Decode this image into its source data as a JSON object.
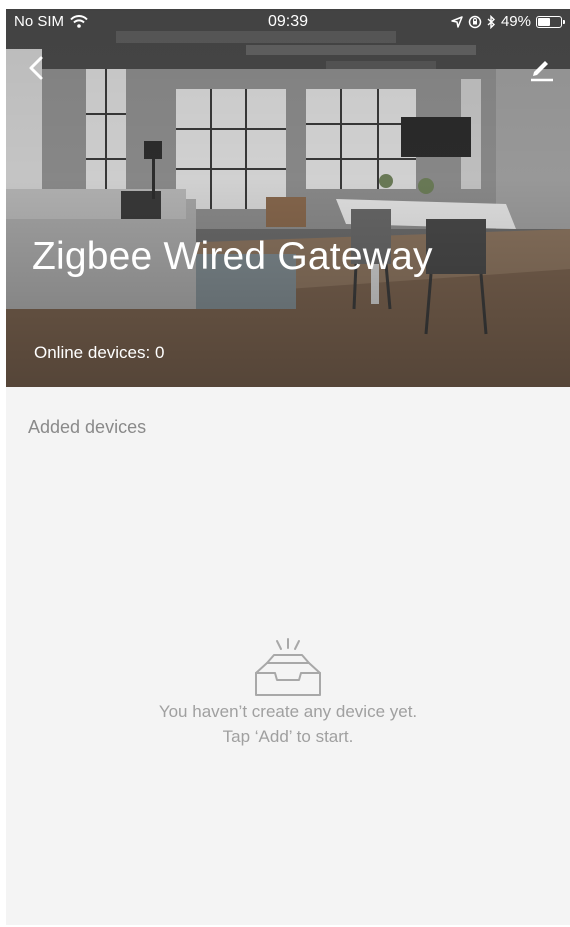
{
  "status_bar": {
    "carrier": "No SIM",
    "time": "09:39",
    "battery_percent": "49%",
    "battery_level": 0.49,
    "icons": [
      "wifi-icon",
      "location-icon",
      "orientation-lock-icon",
      "bluetooth-icon",
      "battery-icon"
    ]
  },
  "header": {
    "back_icon": "chevron-left-icon",
    "edit_icon": "pencil-icon",
    "title": "Zigbee Wired Gateway",
    "online_label": "Online devices:",
    "online_count": "0"
  },
  "content": {
    "section_label": "Added devices",
    "empty_icon": "empty-inbox-icon",
    "empty_line1": "You haven’t create any device yet.",
    "empty_line2": "Tap ‘Add’ to start."
  },
  "colors": {
    "background": "#f4f4f4",
    "muted_text": "#8a8a8a",
    "empty_text": "#a0a0a0"
  }
}
